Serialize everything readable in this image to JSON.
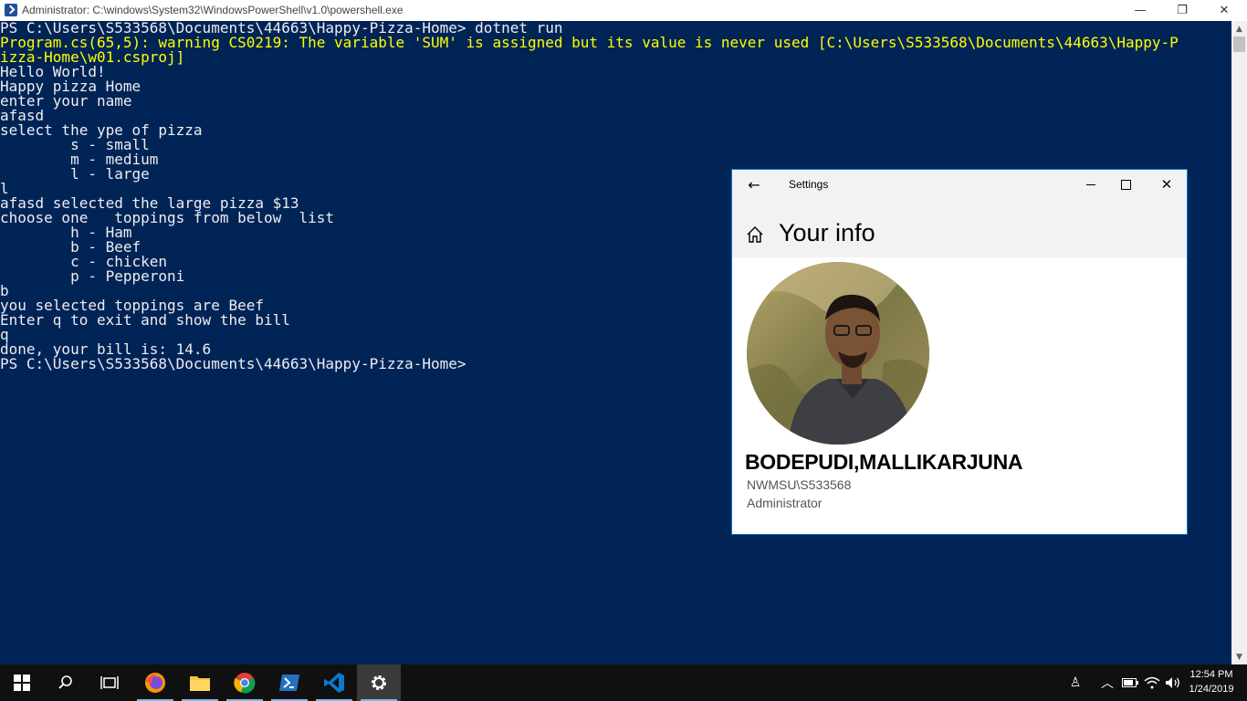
{
  "powershell": {
    "title": "Administrator: C:\\windows\\System32\\WindowsPowerShell\\v1.0\\powershell.exe",
    "window_controls": {
      "minimize": "—",
      "maximize": "❐",
      "close": "✕"
    },
    "lines": [
      {
        "text": "PS C:\\Users\\S533568\\Documents\\44663\\Happy-Pizza-Home> dotnet run",
        "type": "normal"
      },
      {
        "text": "Program.cs(65,5): warning CS0219: The variable 'SUM' is assigned but its value is never used [C:\\Users\\S533568\\Documents\\44663\\Happy-P",
        "type": "warn"
      },
      {
        "text": "izza-Home\\w01.csproj]",
        "type": "warn"
      },
      {
        "text": "Hello World!",
        "type": "normal"
      },
      {
        "text": "Happy pizza Home",
        "type": "normal"
      },
      {
        "text": "enter your name",
        "type": "normal"
      },
      {
        "text": "afasd",
        "type": "normal"
      },
      {
        "text": "select the ype of pizza",
        "type": "normal"
      },
      {
        "text": "        s - small",
        "type": "normal"
      },
      {
        "text": "        m - medium",
        "type": "normal"
      },
      {
        "text": "        l - large",
        "type": "normal"
      },
      {
        "text": "l",
        "type": "normal"
      },
      {
        "text": "afasd selected the large pizza $13",
        "type": "normal"
      },
      {
        "text": "choose one   toppings from below  list",
        "type": "normal"
      },
      {
        "text": "        h - Ham",
        "type": "normal"
      },
      {
        "text": "        b - Beef",
        "type": "normal"
      },
      {
        "text": "        c - chicken",
        "type": "normal"
      },
      {
        "text": "        p - Pepperoni",
        "type": "normal"
      },
      {
        "text": "b",
        "type": "normal"
      },
      {
        "text": "you selected toppings are Beef",
        "type": "normal"
      },
      {
        "text": "Enter q to exit and show the bill",
        "type": "normal"
      },
      {
        "text": "q",
        "type": "normal"
      },
      {
        "text": "done, your bill is: 14.6",
        "type": "normal"
      },
      {
        "text": "PS C:\\Users\\S533568\\Documents\\44663\\Happy-Pizza-Home>",
        "type": "normal"
      }
    ]
  },
  "settings": {
    "title": "Settings",
    "back_icon": "←",
    "close_icon": "✕",
    "heading": "Your info",
    "user_name": "BODEPUDI,MALLIKARJUNA",
    "account": "NWMSU\\S533568",
    "role": "Administrator",
    "accent": "#0078d7"
  },
  "taskbar": {
    "apps": [
      "windows-start-icon",
      "search-icon",
      "task-view-icon",
      "firefox-icon",
      "file-explorer-icon",
      "chrome-icon",
      "powershell-icon",
      "vscode-icon",
      "settings-gear-icon"
    ],
    "tray": {
      "people": "♙",
      "chevron": "︿"
    },
    "clock": {
      "time": "12:54 PM",
      "date": "1/24/2019"
    }
  },
  "colors": {
    "console_bg": "#012456",
    "console_fg": "#eeedf0",
    "warning_fg": "#ffff00",
    "taskbar_bg": "#101010"
  }
}
